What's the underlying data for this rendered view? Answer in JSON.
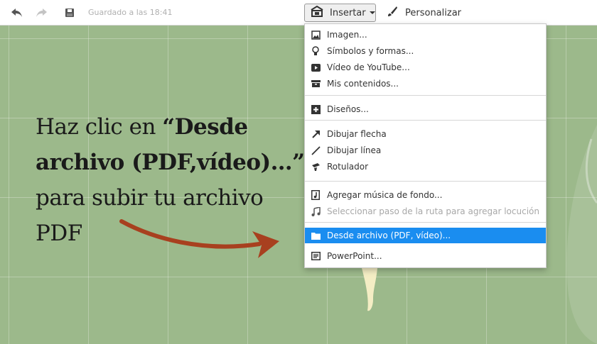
{
  "toolbar": {
    "saved_status": "Guardado a las 18:41",
    "insert_label": "Insertar",
    "customize_label": "Personalizar"
  },
  "canvas": {
    "instruction_pre": "Haz clic en ",
    "instruction_bold": "“Desde archivo (PDF,vídeo)…”",
    "instruction_post": " para subir tu archivo PDF",
    "background_color": "#9cb98b",
    "arrow_color": "#a8401f"
  },
  "insert_menu": {
    "groups": [
      [
        {
          "label": "Imagen...",
          "icon": "image-icon"
        },
        {
          "label": "Símbolos y formas...",
          "icon": "lightbulb-icon"
        },
        {
          "label": "Vídeo de YouTube...",
          "icon": "youtube-icon"
        },
        {
          "label": "Mis contenidos...",
          "icon": "archive-icon"
        }
      ],
      [
        {
          "label": "Diseños...",
          "icon": "plus-box-icon"
        }
      ],
      [
        {
          "label": "Dibujar flecha",
          "icon": "arrow-icon"
        },
        {
          "label": "Dibujar línea",
          "icon": "line-icon"
        },
        {
          "label": "Rotulador",
          "icon": "marker-icon"
        }
      ],
      [
        {
          "label": "Agregar música de fondo...",
          "icon": "music-file-icon"
        },
        {
          "label": "Seleccionar paso de la ruta para agregar locución",
          "icon": "music-note-icon",
          "disabled": true
        }
      ],
      [
        {
          "label": "Desde archivo (PDF, vídeo)...",
          "icon": "folder-icon",
          "active": true
        },
        {
          "label": "PowerPoint...",
          "icon": "powerpoint-icon"
        }
      ]
    ],
    "active_color": "#1a8df0"
  }
}
